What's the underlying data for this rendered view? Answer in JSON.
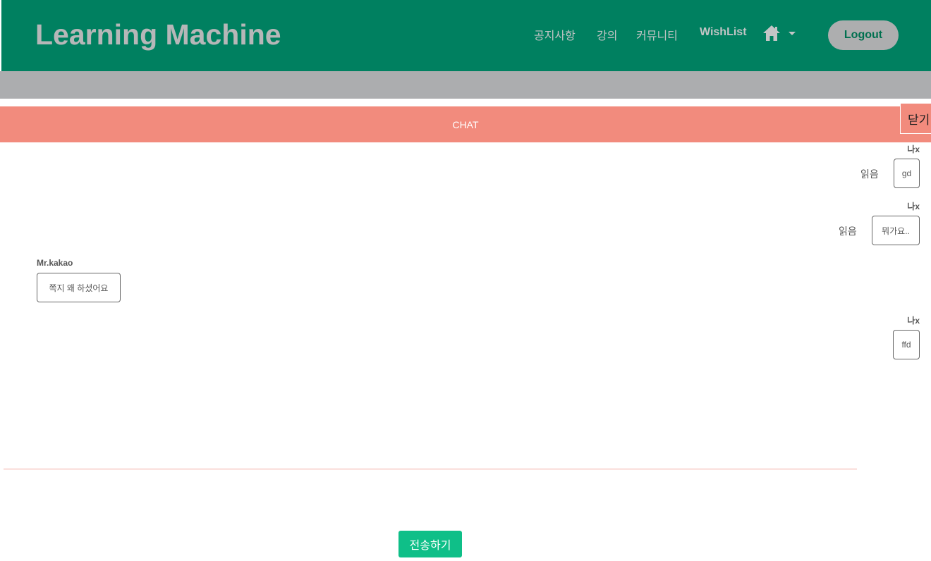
{
  "header": {
    "brand": "Learning Machine",
    "nav": [
      "공지사항",
      "강의",
      "커뮤니티",
      "WishList"
    ],
    "home_icon": "home-icon",
    "logout_label": "Logout"
  },
  "chat": {
    "title": "CHAT",
    "close_label": "닫기",
    "messages": [
      {
        "sender": "나x",
        "text": "gd",
        "status": "읽음",
        "mine": true
      },
      {
        "sender": "나x",
        "text": "뭐가요..",
        "status": "읽음",
        "mine": true
      },
      {
        "sender": "Mr.kakao",
        "text": "쪽지 왜 하셨어요",
        "status": "",
        "mine": false
      },
      {
        "sender": "나x",
        "text": "ffd",
        "status": "",
        "mine": true
      }
    ],
    "send_label": "전송하기"
  },
  "colors": {
    "navbar": "#008060",
    "chat_header": "#f28b7d",
    "send_button": "#0fbf88"
  }
}
